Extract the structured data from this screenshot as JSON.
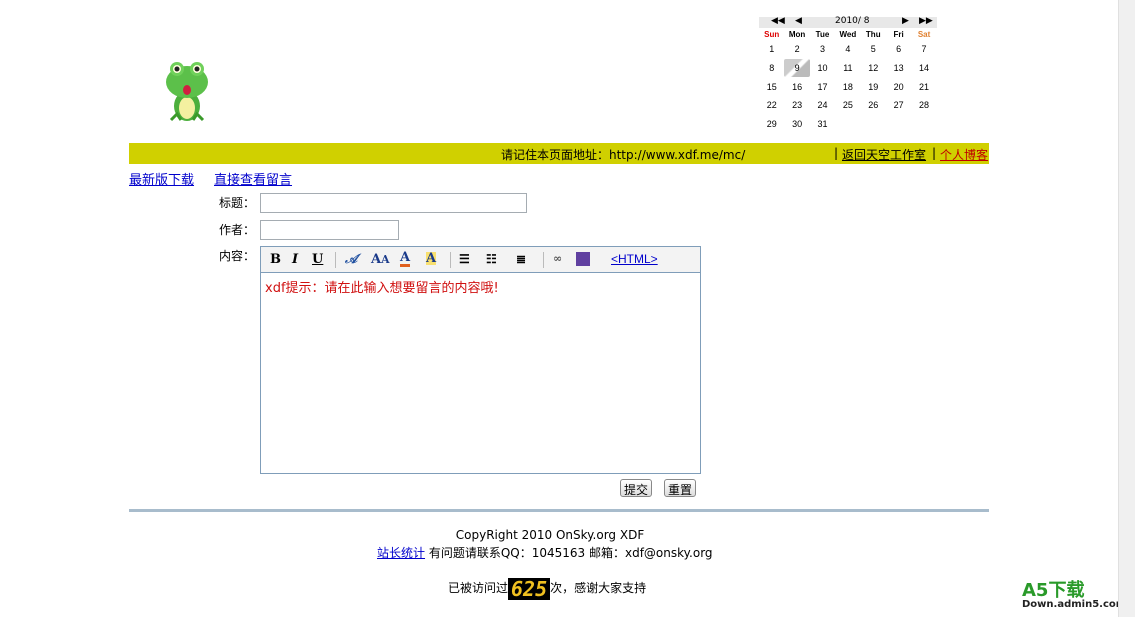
{
  "calendar": {
    "prev_year": "◀◀",
    "prev_month": "◀",
    "title": "2010/ 8",
    "next_month": "▶",
    "next_year": "▶▶",
    "weekdays": [
      "Sun",
      "Mon",
      "Tue",
      "Wed",
      "Thu",
      "Fri",
      "Sat"
    ],
    "weeks": [
      [
        "1",
        "2",
        "3",
        "4",
        "5",
        "6",
        "7"
      ],
      [
        "8",
        "9",
        "10",
        "11",
        "12",
        "13",
        "14"
      ],
      [
        "15",
        "16",
        "17",
        "18",
        "19",
        "20",
        "21"
      ],
      [
        "22",
        "23",
        "24",
        "25",
        "26",
        "27",
        "28"
      ],
      [
        "29",
        "30",
        "31",
        "",
        "",
        "",
        ""
      ]
    ],
    "today": "9"
  },
  "bar": {
    "address_text": "请记住本页面地址：http://www.xdf.me/mc/",
    "sep1": "|",
    "link1": "返回天空工作室",
    "sep2": "|",
    "link2": "个人博客"
  },
  "nav": {
    "download": "最新版下载",
    "view": "直接查看留言"
  },
  "form": {
    "title_label": "标题：",
    "title_value": "",
    "author_label": "作者：",
    "author_value": "",
    "content_label": "内容：",
    "content_placeholder": "xdf提示：请在此输入想要留言的内容哦!",
    "submit": "提交",
    "reset": "重置"
  },
  "toolbar": {
    "bold": "B",
    "italic": "I",
    "underline": "U",
    "html": "<HTML>"
  },
  "footer": {
    "copyright": "CopyRight 2010 OnSky.org XDF",
    "stats_link": "站长统计",
    "contact": "有问题请联系QQ：1045163 邮箱：xdf@onsky.org",
    "visits_before": "已被访问过",
    "visits_count": "625",
    "visits_after": "次，感谢大家支持"
  },
  "watermark": {
    "brand": "A5下载",
    "site": "Down.admin5.com"
  }
}
